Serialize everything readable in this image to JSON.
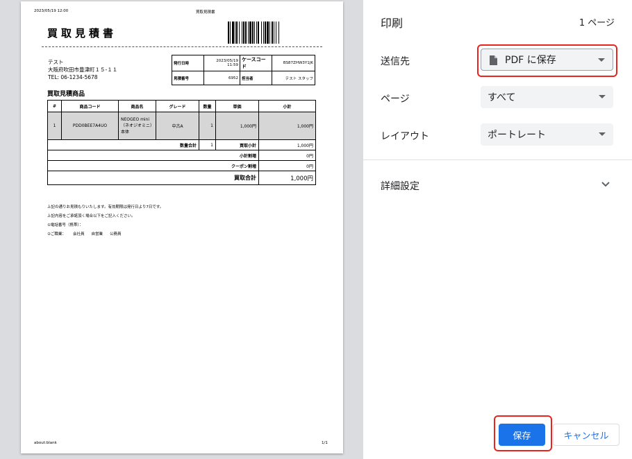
{
  "preview": {
    "header_date": "2023/05/19 12:00",
    "header_title": "買取見積書",
    "doc_title": "買取見積書",
    "customer": {
      "name": "テスト",
      "address": "大阪府吹田市豊津町１５-１１",
      "tel": "TEL: 06-1234-5678"
    },
    "info": {
      "issue_label": "発行日時",
      "issue_value": "2023/05/19 11:59",
      "case_label": "ケースコード",
      "case_value": "BS87ZHW3Y1JK",
      "estimate_label": "見積番号",
      "estimate_value": "6952",
      "staff_label": "担当者",
      "staff_value": "テスト スタッフ"
    },
    "items_title": "買取見積商品",
    "columns": [
      "#",
      "商品コード",
      "商品名",
      "グレード",
      "数量",
      "単価",
      "小計"
    ],
    "row": {
      "no": "1",
      "code": "PDD0BEE7A4UO",
      "name": "NEOGEO mini （ネオジオミニ）本体",
      "grade": "中古A",
      "qty": "1",
      "price": "1,000円",
      "subtotal": "1,000円"
    },
    "summary": {
      "qty_total_label": "数量合計",
      "qty_total": "1",
      "buy_subtotal_label": "買取小計",
      "buy_subtotal": "1,000円",
      "subtotal_add_label": "小計割増",
      "subtotal_add": "0円",
      "coupon_label": "クーポン割増",
      "coupon": "0円",
      "total_label": "買取合計",
      "total": "1,000円"
    },
    "notes": {
      "line1": "上記の通りお見積もりいたします。有効期限は発行日より7日です。",
      "line2": "上記内容をご承諾頂く場合以下をご記入ください。",
      "line3": "①電話番号（携帯）：",
      "line4": "②ご職業：",
      "opt1": "会社員",
      "opt2": "自営業",
      "opt3": "公務員"
    },
    "footer_left": "about:blank",
    "footer_right": "1/1"
  },
  "panel": {
    "title": "印刷",
    "page_count": "1 ページ",
    "destination_label": "送信先",
    "destination_value": "PDF に保存",
    "pages_label": "ページ",
    "pages_value": "すべて",
    "layout_label": "レイアウト",
    "layout_value": "ポートレート",
    "more_settings": "詳細設定",
    "save_button": "保存",
    "cancel_button": "キャンセル"
  },
  "colors": {
    "accent": "#1a73e8",
    "highlight": "#e8241f"
  }
}
